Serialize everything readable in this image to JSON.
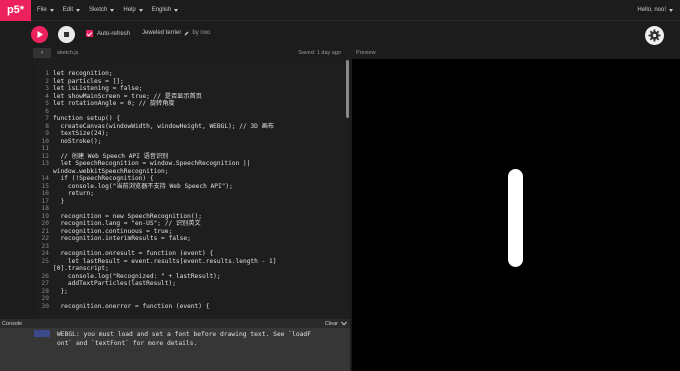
{
  "nav": {
    "logo": "p5*",
    "menu": [
      "File",
      "Edit",
      "Sketch",
      "Help",
      "English"
    ],
    "user": "Hello, noo!"
  },
  "toolbar": {
    "auto_refresh_label": "Auto-refresh",
    "auto_refresh_checked": true,
    "project_name": "Jeweled terrier",
    "by_label": "by noo"
  },
  "editor": {
    "filename": "sketch.js",
    "saved": "Saved: 1 day ago",
    "lines": [
      {
        "n": "1",
        "text": "let recognition;"
      },
      {
        "n": "2",
        "text": "let particles = [];"
      },
      {
        "n": "3",
        "text": "let isListening = false;"
      },
      {
        "n": "4",
        "text": "let showMainScreen = true; // 是否显示首页"
      },
      {
        "n": "5",
        "text": "let rotationAngle = 0; // 旋转角度"
      },
      {
        "n": "6",
        "text": ""
      },
      {
        "n": "7",
        "text": "function setup() {"
      },
      {
        "n": "8",
        "text": "  createCanvas(windowWidth, windowHeight, WEBGL); // 3D 画布"
      },
      {
        "n": "9",
        "text": "  textSize(24);"
      },
      {
        "n": "10",
        "text": "  noStroke();"
      },
      {
        "n": "11",
        "text": ""
      },
      {
        "n": "12",
        "text": "  // 创建 Web Speech API 语音识别"
      },
      {
        "n": "13",
        "text": "  let SpeechRecognition = window.SpeechRecognition ||"
      },
      {
        "n": "",
        "text": "window.webkitSpeechRecognition;"
      },
      {
        "n": "14",
        "text": "  if (!SpeechRecognition) {"
      },
      {
        "n": "15",
        "text": "    console.log(\"当前浏览器不支持 Web Speech API\");"
      },
      {
        "n": "16",
        "text": "    return;"
      },
      {
        "n": "17",
        "text": "  }"
      },
      {
        "n": "18",
        "text": ""
      },
      {
        "n": "19",
        "text": "  recognition = new SpeechRecognition();"
      },
      {
        "n": "20",
        "text": "  recognition.lang = \"en-US\"; // 识别英文"
      },
      {
        "n": "21",
        "text": "  recognition.continuous = true;"
      },
      {
        "n": "22",
        "text": "  recognition.interimResults = false;"
      },
      {
        "n": "23",
        "text": ""
      },
      {
        "n": "24",
        "text": "  recognition.onresult = function (event) {"
      },
      {
        "n": "25",
        "text": "    let lastResult = event.results[event.results.length - 1]"
      },
      {
        "n": "",
        "text": "[0].transcript;"
      },
      {
        "n": "26",
        "text": "    console.log(\"Recognized: \" + lastResult);"
      },
      {
        "n": "27",
        "text": "    addTextParticles(lastResult);"
      },
      {
        "n": "28",
        "text": "  };"
      },
      {
        "n": "29",
        "text": ""
      },
      {
        "n": "30",
        "text": "  recognition.onerror = function (event) {"
      }
    ]
  },
  "preview": {
    "header": "Preview"
  },
  "console": {
    "title": "Console",
    "clear_label": "Clear",
    "message": "WEBGL: you must load and set a font before drawing text. See `loadF\nont` and `textFont` for more details."
  },
  "colors": {
    "accent": "#ed225d",
    "editor_bg": "#1e1e1e",
    "preview_bg": "#000000"
  }
}
